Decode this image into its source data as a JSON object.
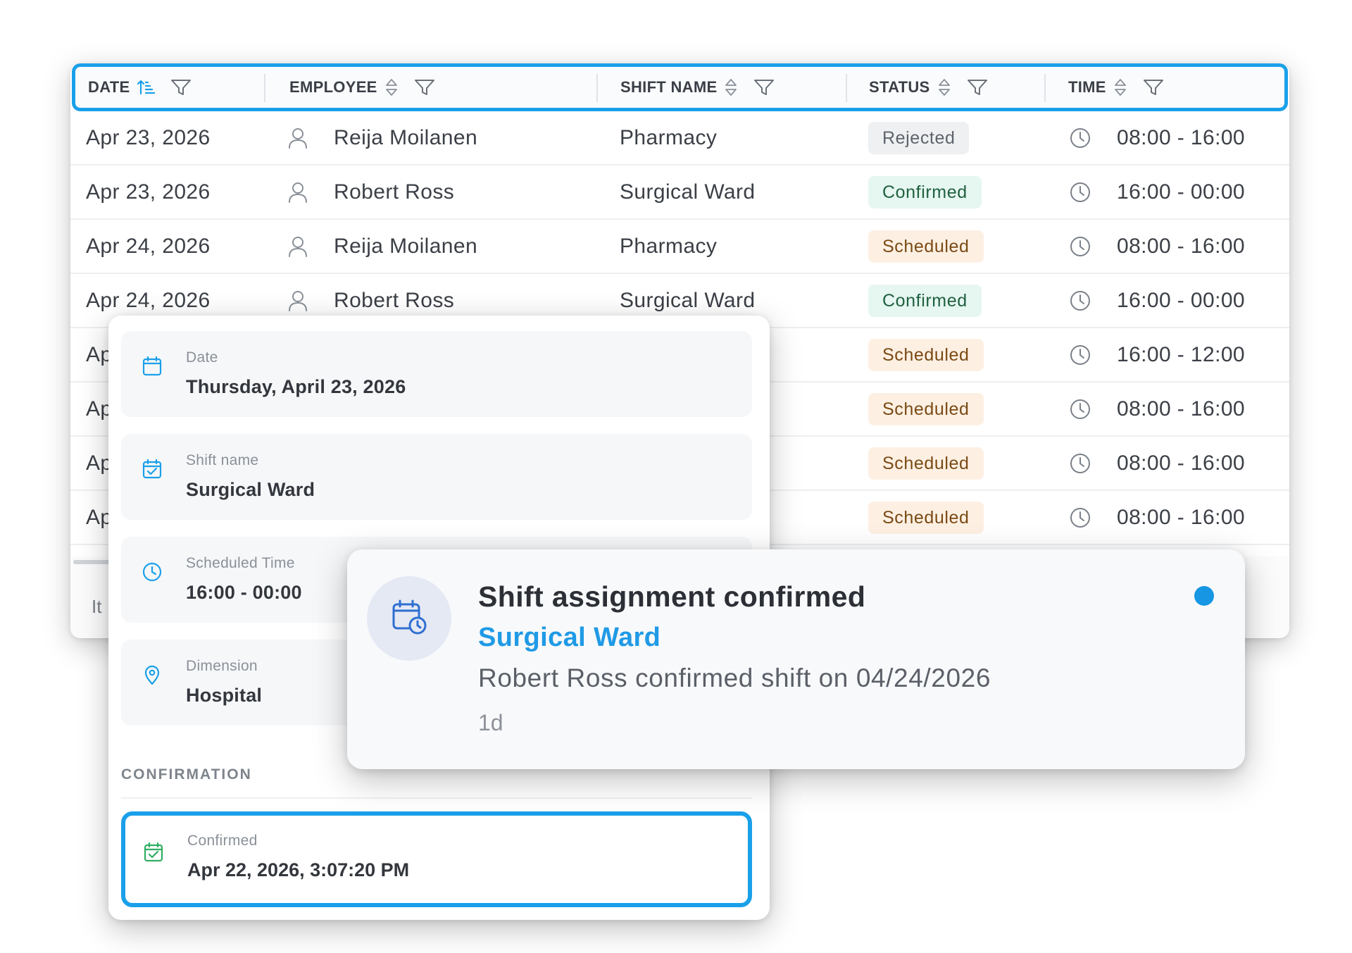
{
  "table": {
    "columns": [
      {
        "label": "DATE",
        "sort": "ascending"
      },
      {
        "label": "EMPLOYEE",
        "sort": "none"
      },
      {
        "label": "SHIFT NAME",
        "sort": "none"
      },
      {
        "label": "STATUS",
        "sort": "none"
      },
      {
        "label": "TIME",
        "sort": "none"
      }
    ],
    "rows": [
      {
        "date": "Apr 23, 2026",
        "employee": "Reija Moilanen",
        "shift": "Pharmacy",
        "status": "Rejected",
        "time": "08:00 - 16:00"
      },
      {
        "date": "Apr 23, 2026",
        "employee": "Robert Ross",
        "shift": "Surgical Ward",
        "status": "Confirmed",
        "time": "16:00 - 00:00"
      },
      {
        "date": "Apr 24, 2026",
        "employee": "Reija Moilanen",
        "shift": "Pharmacy",
        "status": "Scheduled",
        "time": "08:00 - 16:00"
      },
      {
        "date": "Apr 24, 2026",
        "employee": "Robert Ross",
        "shift": "Surgical Ward",
        "status": "Confirmed",
        "time": "16:00 - 00:00"
      },
      {
        "date": "Ap",
        "employee": "",
        "shift": "",
        "status": "Scheduled",
        "time": "16:00 - 12:00"
      },
      {
        "date": "Ap",
        "employee": "",
        "shift": "",
        "status": "Scheduled",
        "time": "08:00 - 16:00"
      },
      {
        "date": "Ap",
        "employee": "",
        "shift": "",
        "status": "Scheduled",
        "time": "08:00 - 16:00"
      },
      {
        "date": "Ap",
        "employee": "",
        "shift": "",
        "status": "Scheduled",
        "time": "08:00 - 16:00"
      }
    ],
    "footer_text": "It",
    "status_colors": {
      "Rejected": {
        "bg": "#eef0f2",
        "fg": "#5e646c"
      },
      "Confirmed": {
        "bg": "#e6f6f1",
        "fg": "#20613f"
      },
      "Scheduled": {
        "bg": "#fdf0e3",
        "fg": "#7a4a14"
      }
    }
  },
  "detail": {
    "date": {
      "label": "Date",
      "value": "Thursday, April 23, 2026",
      "icon": "calendar-icon"
    },
    "shift_name": {
      "label": "Shift name",
      "value": "Surgical Ward",
      "icon": "calendar-check-icon"
    },
    "scheduled_time": {
      "label": "Scheduled Time",
      "value": "16:00 - 00:00",
      "icon": "clock-icon"
    },
    "dimension": {
      "label": "Dimension",
      "value": "Hospital",
      "icon": "location-pin-icon"
    },
    "section_title": "CONFIRMATION",
    "confirmed": {
      "label": "Confirmed",
      "value": "Apr 22, 2026, 3:07:20 PM",
      "icon": "calendar-check-green-icon"
    }
  },
  "notification": {
    "title": "Shift assignment confirmed",
    "subtitle": "Surgical Ward",
    "body": "Robert Ross confirmed shift on 04/24/2026",
    "time_ago": "1d",
    "unread": true,
    "icon": "calendar-clock-icon"
  },
  "colors": {
    "accent": "#1aa0ea",
    "link": "#1f9ae6",
    "unread_dot": "#1696e3"
  }
}
